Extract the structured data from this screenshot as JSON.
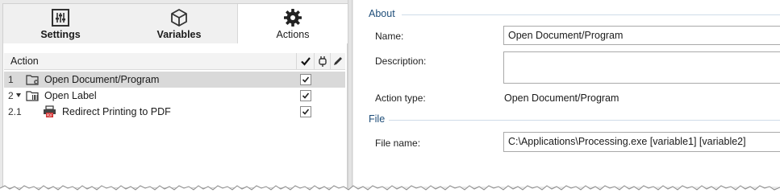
{
  "tabs": [
    {
      "label": "Settings",
      "icon": "sliders-icon",
      "active": false
    },
    {
      "label": "Variables",
      "icon": "cube-icon",
      "active": false
    },
    {
      "label": "Actions",
      "icon": "gear-icon",
      "active": true
    }
  ],
  "tree": {
    "header": "Action",
    "column_icons": [
      "checkmark-icon",
      "plug-icon",
      "pencil-icon"
    ],
    "rows": [
      {
        "num": "1",
        "label": "Open Document/Program",
        "icon": "folder-gear-icon",
        "expander": false,
        "checked": true,
        "selected": true
      },
      {
        "num": "2",
        "label": "Open Label",
        "icon": "folder-barcode-icon",
        "expander": true,
        "checked": true,
        "selected": false
      },
      {
        "num": "2.1",
        "label": "Redirect Printing to PDF",
        "icon": "printer-pdf-icon",
        "expander": false,
        "checked": true,
        "selected": false
      }
    ]
  },
  "about": {
    "section": "About",
    "name_label": "Name:",
    "name_value": "Open Document/Program",
    "description_label": "Description:",
    "description_value": "",
    "action_type_label": "Action type:",
    "action_type_value": "Open Document/Program"
  },
  "file": {
    "section": "File",
    "file_name_label": "File name:",
    "file_name_value": "C:\\Applications\\Processing.exe [variable1] [variable2]"
  },
  "colors": {
    "section_heading": "#1f4e79",
    "selected_row": "#d9d9d9",
    "tab_bar": "#f0f0f0"
  }
}
